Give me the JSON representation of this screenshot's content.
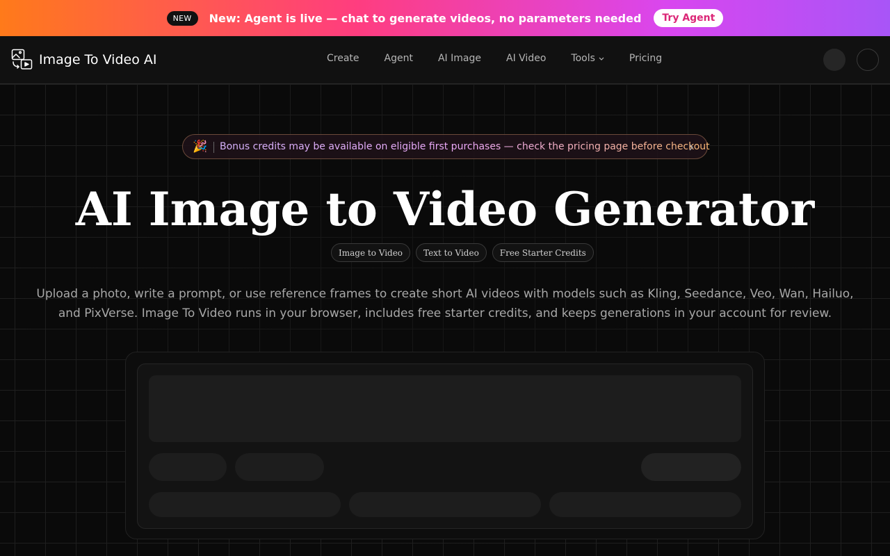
{
  "banner": {
    "badge": "NEW",
    "text": "New: Agent is live — chat to generate videos, no parameters needed",
    "cta": "Try Agent"
  },
  "nav": {
    "brand": "Image To Video AI",
    "links": [
      "Create",
      "Agent",
      "AI Image",
      "AI Video",
      "Tools",
      "Pricing"
    ]
  },
  "hero": {
    "promo_icon": "🎉",
    "promo": "Bonus credits may be available on eligible first purchases — check the pricing page before checkout",
    "title": "AI Image to Video Generator",
    "tags": [
      "Image to Video",
      "Text to Video",
      "Free Starter Credits"
    ],
    "description": "Upload a photo, write a prompt, or use reference frames to create short AI videos with models such as Kling, Seedance, Veo, Wan, Hailuo, and PixVerse. Image To Video runs in your browser, includes free starter credits, and keeps generations in your account for review."
  },
  "icons": {
    "logo": "image-to-video-icon",
    "tools_dropdown": "chevron-down-icon",
    "promo_arrow": "chevron-right-icon"
  },
  "colors": {
    "banner_gradient_start": "#ff7a1a",
    "banner_gradient_end": "#a855f7",
    "cta_text": "#db2777",
    "background": "#0a0a0a"
  }
}
